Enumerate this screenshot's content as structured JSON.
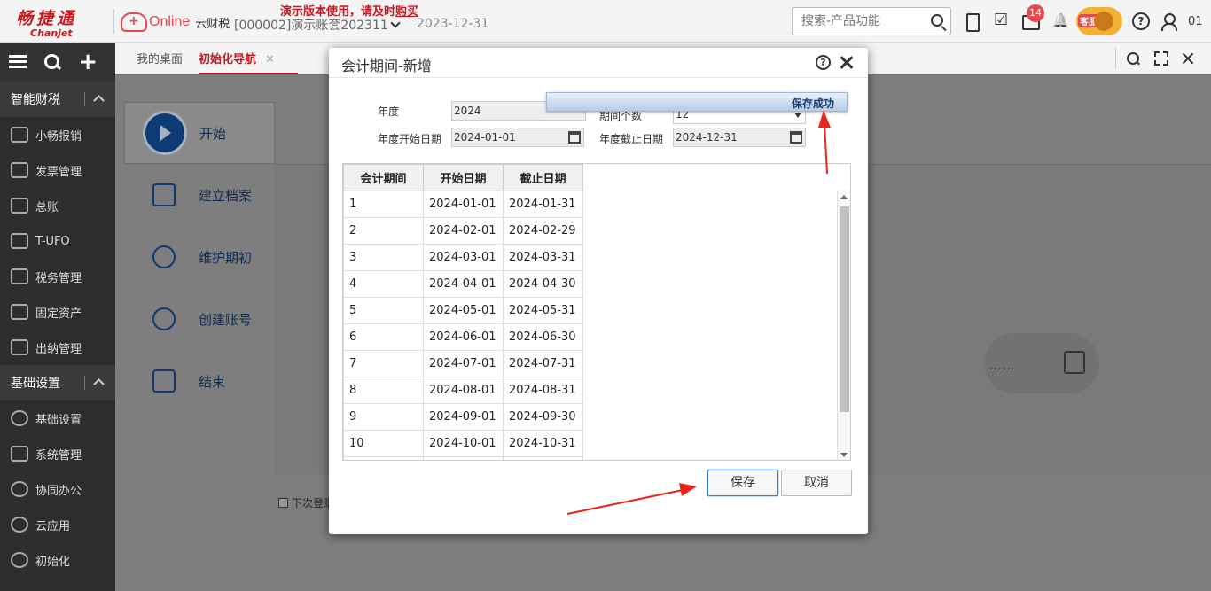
{
  "topbar": {
    "logo_cn": "畅捷通",
    "logo_en": "Chanjet",
    "online": "Online",
    "product": "云财税",
    "account": "[000002]演示账套202311",
    "demo_note_pre": "演示版本使用，请及时",
    "demo_note_buy": "购买",
    "date": "2023-12-31",
    "search_placeholder": "搜索-产品功能",
    "badge_count": "14",
    "mascot_label": "客服",
    "user": "01"
  },
  "sidebar": {
    "groups": [
      {
        "label": "智能财税"
      },
      {
        "label": "基础设置"
      }
    ],
    "items_a": [
      "小畅报销",
      "发票管理",
      "总账",
      "T-UFO",
      "税务管理",
      "固定资产",
      "出纳管理"
    ],
    "items_b": [
      "基础设置",
      "系统管理",
      "协同办公",
      "云应用",
      "初始化"
    ]
  },
  "tabs": {
    "desk": "我的桌面",
    "wizard": "初始化导航",
    "close": "✕"
  },
  "wizard": {
    "steps": [
      "开始",
      "建立档案",
      "维护期初",
      "创建账号",
      "结束"
    ],
    "dots": "……",
    "next_login": "下次登录"
  },
  "modal": {
    "title": "会计期间-新增",
    "labels": {
      "year": "年度",
      "period_count": "期间个数",
      "start_date": "年度开始日期",
      "end_date": "年度截止日期"
    },
    "values": {
      "year": "2024",
      "period_count": "12",
      "start_date": "2024-01-01",
      "end_date": "2024-12-31"
    },
    "toast": "保存成功",
    "columns": [
      "会计期间",
      "开始日期",
      "截止日期"
    ],
    "rows": [
      [
        "1",
        "2024-01-01",
        "2024-01-31"
      ],
      [
        "2",
        "2024-02-01",
        "2024-02-29"
      ],
      [
        "3",
        "2024-03-01",
        "2024-03-31"
      ],
      [
        "4",
        "2024-04-01",
        "2024-04-30"
      ],
      [
        "5",
        "2024-05-01",
        "2024-05-31"
      ],
      [
        "6",
        "2024-06-01",
        "2024-06-30"
      ],
      [
        "7",
        "2024-07-01",
        "2024-07-31"
      ],
      [
        "8",
        "2024-08-01",
        "2024-08-31"
      ],
      [
        "9",
        "2024-09-01",
        "2024-09-30"
      ],
      [
        "10",
        "2024-10-01",
        "2024-10-31"
      ]
    ],
    "save": "保存",
    "cancel": "取消"
  },
  "colors": {
    "brand_red": "#c8161d",
    "annotation_red": "#e8261c",
    "save_border": "#3a7bd5"
  }
}
